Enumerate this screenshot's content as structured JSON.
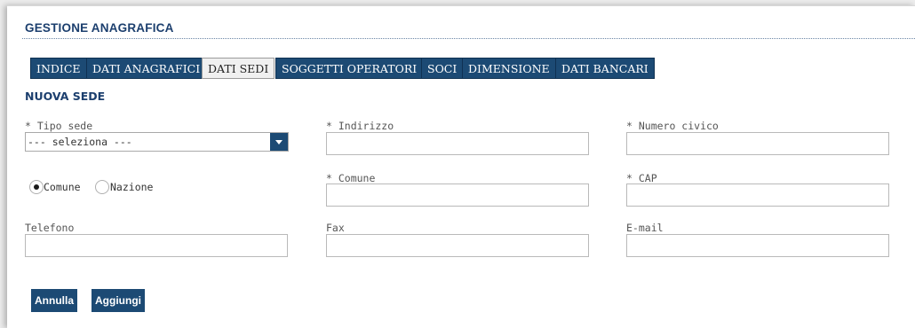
{
  "header": {
    "title": "GESTIONE ANAGRAFICA"
  },
  "tabs": [
    {
      "label": "INDICE",
      "active": false
    },
    {
      "label": "DATI ANAGRAFICI",
      "active": false
    },
    {
      "label": "DATI SEDI",
      "active": true
    },
    {
      "label": "SOGGETTI OPERATORI",
      "active": false
    },
    {
      "label": "SOCI",
      "active": false
    },
    {
      "label": "DIMENSIONE",
      "active": false
    },
    {
      "label": "DATI BANCARI",
      "active": false
    }
  ],
  "section": {
    "title": "NUOVA SEDE"
  },
  "form": {
    "tipo_sede": {
      "label": "* Tipo sede",
      "value": "--- seleziona ---"
    },
    "indirizzo": {
      "label": "* Indirizzo",
      "value": ""
    },
    "numero_civico": {
      "label": "* Numero civico",
      "value": ""
    },
    "location_type": {
      "options": [
        "Comune",
        "Nazione"
      ],
      "selected": "Comune"
    },
    "comune": {
      "label": "* Comune",
      "value": ""
    },
    "cap": {
      "label": "* CAP",
      "value": ""
    },
    "telefono": {
      "label": "Telefono",
      "value": ""
    },
    "fax": {
      "label": "Fax",
      "value": ""
    },
    "email": {
      "label": "E-mail",
      "value": ""
    }
  },
  "actions": {
    "cancel": "Annulla",
    "add": "Aggiungi"
  },
  "colors": {
    "brand": "#1c4a74",
    "title": "#1c3f6e"
  }
}
